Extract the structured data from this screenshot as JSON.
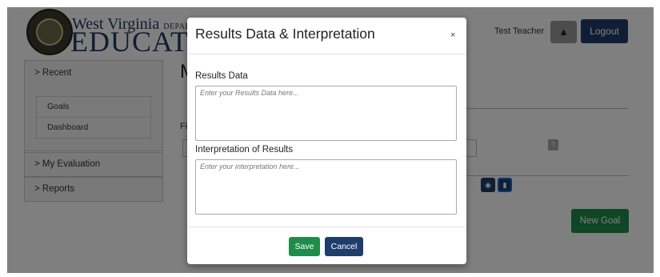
{
  "header": {
    "logo_line1_main": "West Virginia",
    "logo_line1_small": "DEPARTMENT",
    "logo_line2": "EDUCATIO",
    "user_name": "Test Teacher",
    "bell_icon": "bell-icon",
    "logout_label": "Logout"
  },
  "sidebar": {
    "recent_label": "> Recent",
    "recent_items": [
      "Goals",
      "Dashboard"
    ],
    "my_evaluation_label": "> My Evaluation",
    "reports_label": "> Reports"
  },
  "main": {
    "title_fragment": "M",
    "field_fragment": "Fi",
    "help_icon": "?",
    "view_icon": "eye-icon",
    "document_icon": "document-icon",
    "new_goal_label": "New Goal"
  },
  "modal": {
    "title": "Results Data & Interpretation",
    "close_label": "×",
    "results_data_label": "Results Data",
    "results_data_placeholder": "Enter your Results Data here...",
    "interpretation_label": "Interpretation of Results",
    "interpretation_placeholder": "Enter your interpretation here...",
    "save_label": "Save",
    "cancel_label": "Cancel"
  },
  "colors": {
    "navy": "#1f3d6b",
    "green": "#1f8d4a",
    "overlay": "rgba(0,0,0,0.5)"
  }
}
